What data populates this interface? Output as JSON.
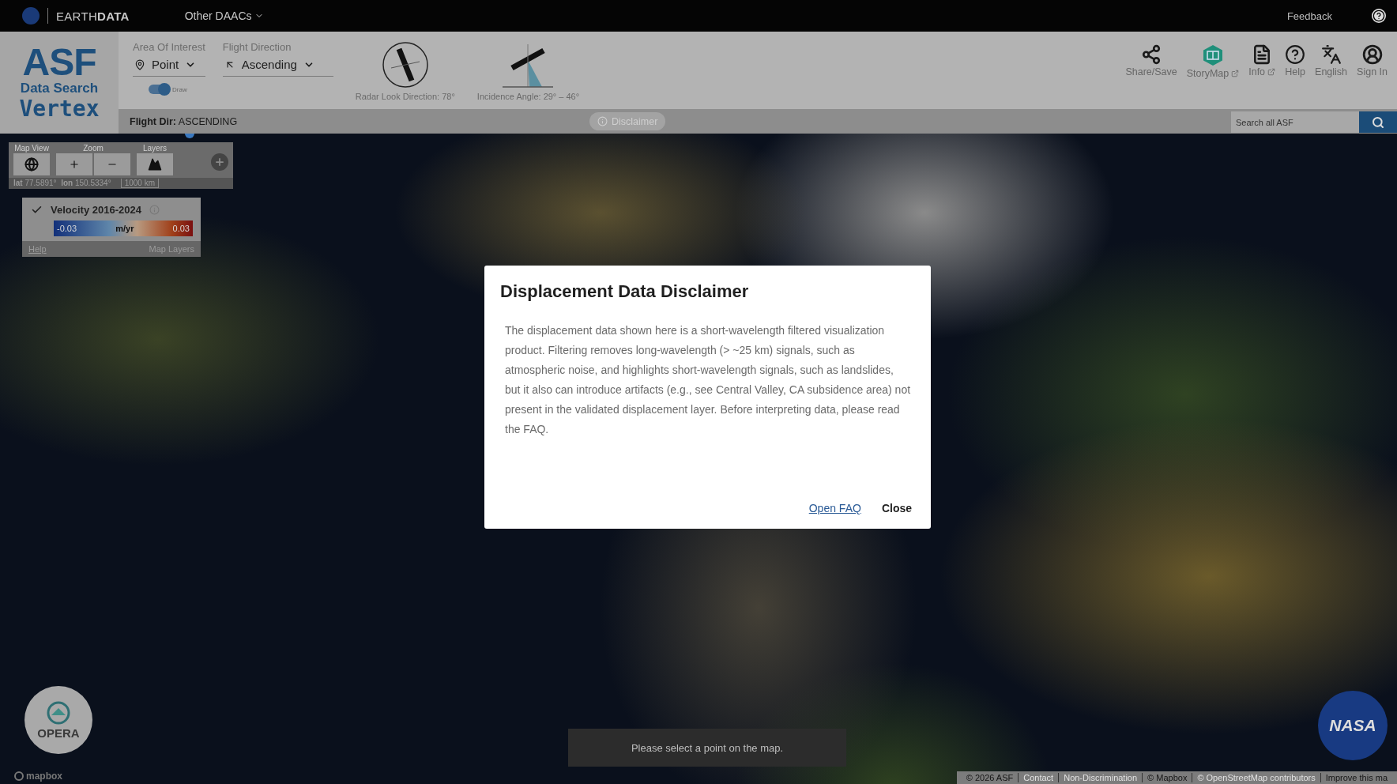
{
  "topbar": {
    "brand": "EARTH**DATA**",
    "menu": "Other DAACs",
    "feedback": "Feedback"
  },
  "logo": {
    "name": "ASF",
    "subtitle": "Data Search",
    "product": "Vertex"
  },
  "filters": [
    {
      "kind": "area",
      "label": "Area Of Interest",
      "value": "Point"
    },
    {
      "kind": "direction",
      "label": "Flight Direction",
      "value": "Ascending"
    }
  ],
  "draw_toggle": {
    "label": "Draw",
    "on": true
  },
  "indicators": [
    {
      "kind": "radar",
      "caption": "Radar Look Direction: 78°"
    },
    {
      "kind": "incidence",
      "caption": "Incidence Angle: 29° – 46°"
    }
  ],
  "actions": [
    {
      "kind": "share",
      "label": "Share/Save",
      "external": false
    },
    {
      "kind": "storymap",
      "label": "StoryMap",
      "external": true
    },
    {
      "kind": "info",
      "label": "Info",
      "external": true
    },
    {
      "kind": "help",
      "label": "Help",
      "external": false
    },
    {
      "kind": "language",
      "label": "English",
      "external": false
    },
    {
      "kind": "user",
      "label": "Sign In",
      "external": false
    }
  ],
  "flight_dir": "**Flight Dir:** ASCENDING",
  "disclaimer_button": "Disclaimer",
  "search": {
    "placeholder": "Search all ASF"
  },
  "map_controls": {
    "groups": [
      {
        "kind": "view",
        "label": "Map View"
      },
      {
        "kind": "zoom",
        "label": "Zoom"
      },
      {
        "kind": "layers",
        "label": "Layers"
      }
    ],
    "coords": "**lat** 77.5891°  **lon** 150.5334°",
    "scale": "1000 km"
  },
  "legend": {
    "checked": true,
    "title": "Velocity 2016-2024",
    "min": "-0.03",
    "unit": "m/yr",
    "max": "0.03",
    "help": "Help",
    "layers": "Map Layers"
  },
  "dialog": {
    "title": "Displacement Data Disclaimer",
    "body": "The displacement data shown here is a short-wavelength filtered visualization product. Filtering removes long-wavelength (> ~25 km) signals, such as atmospheric noise, and highlights short-wavelength signals, such as landslides, but it also can introduce artifacts (e.g., see Central Valley, CA subsidence area) not present in the validated displacement layer. Before interpreting data, please read the FAQ.",
    "actions": [
      {
        "kind": "link",
        "label": "Open FAQ"
      },
      {
        "kind": "button",
        "label": "Close"
      }
    ]
  },
  "toast": "Please select a point on the map.",
  "opera": "OPERA",
  "nasa": "NASA",
  "mapbox": "mapbox",
  "attribution": [
    {
      "kind": "text",
      "label": "© 2026 ASF"
    },
    {
      "kind": "link",
      "label": "Contact"
    },
    {
      "kind": "link",
      "label": "Non-Discrimination"
    },
    {
      "kind": "text",
      "label": "© Mapbox"
    },
    {
      "kind": "link",
      "label": "© OpenStreetMap contributors"
    },
    {
      "kind": "text",
      "label": "Improve this ma"
    }
  ]
}
